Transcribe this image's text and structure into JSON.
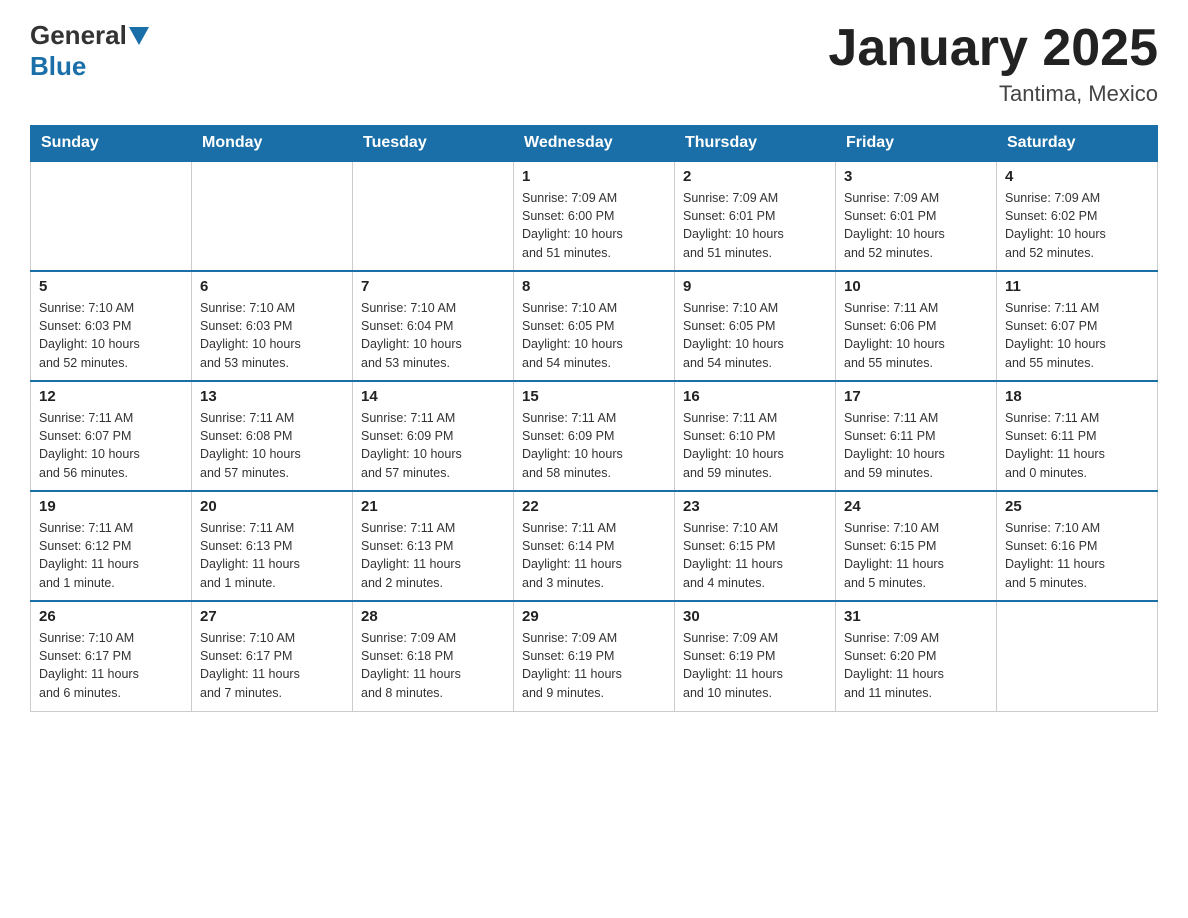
{
  "header": {
    "logo_general": "General",
    "logo_blue": "Blue",
    "month_title": "January 2025",
    "location": "Tantima, Mexico"
  },
  "weekdays": [
    "Sunday",
    "Monday",
    "Tuesday",
    "Wednesday",
    "Thursday",
    "Friday",
    "Saturday"
  ],
  "weeks": [
    [
      {
        "day": "",
        "info": ""
      },
      {
        "day": "",
        "info": ""
      },
      {
        "day": "",
        "info": ""
      },
      {
        "day": "1",
        "info": "Sunrise: 7:09 AM\nSunset: 6:00 PM\nDaylight: 10 hours\nand 51 minutes."
      },
      {
        "day": "2",
        "info": "Sunrise: 7:09 AM\nSunset: 6:01 PM\nDaylight: 10 hours\nand 51 minutes."
      },
      {
        "day": "3",
        "info": "Sunrise: 7:09 AM\nSunset: 6:01 PM\nDaylight: 10 hours\nand 52 minutes."
      },
      {
        "day": "4",
        "info": "Sunrise: 7:09 AM\nSunset: 6:02 PM\nDaylight: 10 hours\nand 52 minutes."
      }
    ],
    [
      {
        "day": "5",
        "info": "Sunrise: 7:10 AM\nSunset: 6:03 PM\nDaylight: 10 hours\nand 52 minutes."
      },
      {
        "day": "6",
        "info": "Sunrise: 7:10 AM\nSunset: 6:03 PM\nDaylight: 10 hours\nand 53 minutes."
      },
      {
        "day": "7",
        "info": "Sunrise: 7:10 AM\nSunset: 6:04 PM\nDaylight: 10 hours\nand 53 minutes."
      },
      {
        "day": "8",
        "info": "Sunrise: 7:10 AM\nSunset: 6:05 PM\nDaylight: 10 hours\nand 54 minutes."
      },
      {
        "day": "9",
        "info": "Sunrise: 7:10 AM\nSunset: 6:05 PM\nDaylight: 10 hours\nand 54 minutes."
      },
      {
        "day": "10",
        "info": "Sunrise: 7:11 AM\nSunset: 6:06 PM\nDaylight: 10 hours\nand 55 minutes."
      },
      {
        "day": "11",
        "info": "Sunrise: 7:11 AM\nSunset: 6:07 PM\nDaylight: 10 hours\nand 55 minutes."
      }
    ],
    [
      {
        "day": "12",
        "info": "Sunrise: 7:11 AM\nSunset: 6:07 PM\nDaylight: 10 hours\nand 56 minutes."
      },
      {
        "day": "13",
        "info": "Sunrise: 7:11 AM\nSunset: 6:08 PM\nDaylight: 10 hours\nand 57 minutes."
      },
      {
        "day": "14",
        "info": "Sunrise: 7:11 AM\nSunset: 6:09 PM\nDaylight: 10 hours\nand 57 minutes."
      },
      {
        "day": "15",
        "info": "Sunrise: 7:11 AM\nSunset: 6:09 PM\nDaylight: 10 hours\nand 58 minutes."
      },
      {
        "day": "16",
        "info": "Sunrise: 7:11 AM\nSunset: 6:10 PM\nDaylight: 10 hours\nand 59 minutes."
      },
      {
        "day": "17",
        "info": "Sunrise: 7:11 AM\nSunset: 6:11 PM\nDaylight: 10 hours\nand 59 minutes."
      },
      {
        "day": "18",
        "info": "Sunrise: 7:11 AM\nSunset: 6:11 PM\nDaylight: 11 hours\nand 0 minutes."
      }
    ],
    [
      {
        "day": "19",
        "info": "Sunrise: 7:11 AM\nSunset: 6:12 PM\nDaylight: 11 hours\nand 1 minute."
      },
      {
        "day": "20",
        "info": "Sunrise: 7:11 AM\nSunset: 6:13 PM\nDaylight: 11 hours\nand 1 minute."
      },
      {
        "day": "21",
        "info": "Sunrise: 7:11 AM\nSunset: 6:13 PM\nDaylight: 11 hours\nand 2 minutes."
      },
      {
        "day": "22",
        "info": "Sunrise: 7:11 AM\nSunset: 6:14 PM\nDaylight: 11 hours\nand 3 minutes."
      },
      {
        "day": "23",
        "info": "Sunrise: 7:10 AM\nSunset: 6:15 PM\nDaylight: 11 hours\nand 4 minutes."
      },
      {
        "day": "24",
        "info": "Sunrise: 7:10 AM\nSunset: 6:15 PM\nDaylight: 11 hours\nand 5 minutes."
      },
      {
        "day": "25",
        "info": "Sunrise: 7:10 AM\nSunset: 6:16 PM\nDaylight: 11 hours\nand 5 minutes."
      }
    ],
    [
      {
        "day": "26",
        "info": "Sunrise: 7:10 AM\nSunset: 6:17 PM\nDaylight: 11 hours\nand 6 minutes."
      },
      {
        "day": "27",
        "info": "Sunrise: 7:10 AM\nSunset: 6:17 PM\nDaylight: 11 hours\nand 7 minutes."
      },
      {
        "day": "28",
        "info": "Sunrise: 7:09 AM\nSunset: 6:18 PM\nDaylight: 11 hours\nand 8 minutes."
      },
      {
        "day": "29",
        "info": "Sunrise: 7:09 AM\nSunset: 6:19 PM\nDaylight: 11 hours\nand 9 minutes."
      },
      {
        "day": "30",
        "info": "Sunrise: 7:09 AM\nSunset: 6:19 PM\nDaylight: 11 hours\nand 10 minutes."
      },
      {
        "day": "31",
        "info": "Sunrise: 7:09 AM\nSunset: 6:20 PM\nDaylight: 11 hours\nand 11 minutes."
      },
      {
        "day": "",
        "info": ""
      }
    ]
  ]
}
